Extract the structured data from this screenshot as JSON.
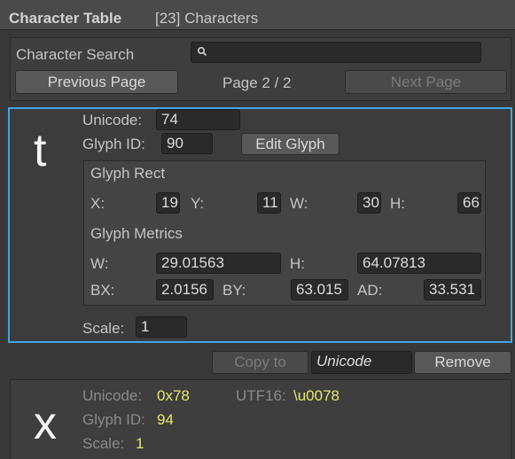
{
  "header": {
    "title": "Character Table",
    "count": "[23] Characters"
  },
  "search": {
    "label": "Character Search",
    "value": ""
  },
  "pager": {
    "prev": "Previous Page",
    "status": "Page 2 / 2",
    "next": "Next Page"
  },
  "selected": {
    "glyph": "t",
    "unicode_label": "Unicode:",
    "unicode": "74",
    "glyph_id_label": "Glyph ID:",
    "glyph_id": "90",
    "edit_glyph": "Edit Glyph",
    "rect": {
      "title": "Glyph Rect",
      "x_label": "X:",
      "x": "19",
      "y_label": "Y:",
      "y": "11",
      "w_label": "W:",
      "w": "30",
      "h_label": "H:",
      "h": "66"
    },
    "metrics": {
      "title": "Glyph Metrics",
      "w_label": "W:",
      "w": "29.01563",
      "h_label": "H:",
      "h": "64.07813",
      "bx_label": "BX:",
      "bx": "2.0156",
      "by_label": "BY:",
      "by": "63.015",
      "ad_label": "AD:",
      "ad": "33.531"
    },
    "scale_label": "Scale:",
    "scale": "1"
  },
  "actions": {
    "copy_to": "Copy to",
    "target": "Unicode",
    "remove": "Remove"
  },
  "next_char": {
    "glyph": "x",
    "unicode_label": "Unicode:",
    "unicode": "0x78",
    "utf16_label": "UTF16:",
    "utf16": "\\u0078",
    "glyph_id_label": "Glyph ID:",
    "glyph_id": "94",
    "scale_label": "Scale:",
    "scale": "1"
  },
  "colors": {
    "accent": "#3ea6e6",
    "value_yellow": "#e6e66a"
  }
}
